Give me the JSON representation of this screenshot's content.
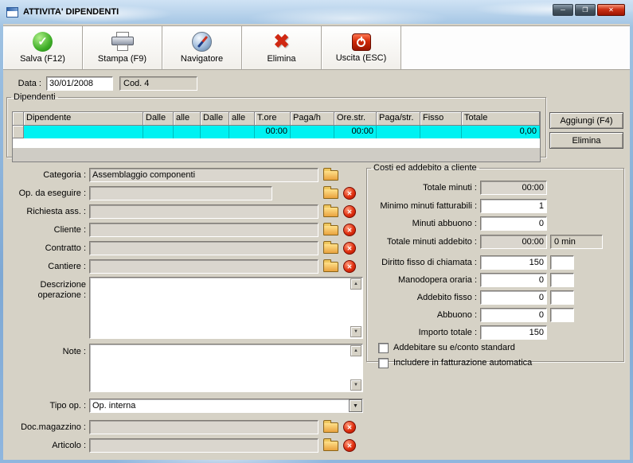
{
  "window": {
    "title": "ATTIVITA' DIPENDENTI"
  },
  "colors": {
    "titlebar": "#9ec1e4",
    "dialog_bg": "#d6d2c6",
    "selected_row": "#00f2f2",
    "close_button": "#cc3014"
  },
  "icons": {
    "check": "✓",
    "cross": "✖",
    "small_cross": "✕",
    "arrow_down": "▼",
    "arrow_up": "▲",
    "minimize": "─",
    "maximize": "❐",
    "close": "✕"
  },
  "toolbar": {
    "salva": "Salva (F12)",
    "stampa": "Stampa (F9)",
    "navigatore": "Navigatore",
    "elimina": "Elimina",
    "uscita": "Uscita (ESC)"
  },
  "header": {
    "data_label": "Data :",
    "data_value": "30/01/2008",
    "cod_value": "Cod. 4"
  },
  "grid": {
    "legend": "Dipendenti",
    "columns": [
      "Dipendente",
      "Dalle",
      "alle",
      "Dalle",
      "alle",
      "T.ore",
      "Paga/h",
      "Ore.str.",
      "Paga/str.",
      "Fisso",
      "Totale"
    ],
    "row": {
      "t_ore": "00:00",
      "ore_str": "00:00",
      "totale": "0,00"
    },
    "aggiungi": "Aggiungi (F4)",
    "elimina": "Elimina"
  },
  "form": {
    "categoria": {
      "label": "Categoria :",
      "value": "Assemblaggio componenti"
    },
    "op_da_eseguire": {
      "label": "Op. da eseguire :",
      "value": ""
    },
    "richiesta_ass": {
      "label": "Richiesta ass. :",
      "value": ""
    },
    "cliente": {
      "label": "Cliente :",
      "value": ""
    },
    "contratto": {
      "label": "Contratto :",
      "value": ""
    },
    "cantiere": {
      "label": "Cantiere :",
      "value": ""
    },
    "descrizione": {
      "label": "Descrizione operazione :",
      "value": ""
    },
    "note": {
      "label": "Note :",
      "value": ""
    },
    "tipo_op": {
      "label": "Tipo op. :",
      "value": "Op. interna"
    },
    "doc_magazzino": {
      "label": "Doc.magazzino :",
      "value": ""
    },
    "articolo": {
      "label": "Articolo :",
      "value": ""
    }
  },
  "costi": {
    "legend": "Costi ed addebito a cliente",
    "totale_minuti": {
      "label": "Totale minuti :",
      "value": "00:00"
    },
    "minimo_minuti": {
      "label": "Minimo minuti fatturabili :",
      "value": "1"
    },
    "minuti_abbuono": {
      "label": "Minuti abbuono :",
      "value": "0"
    },
    "totale_minuti_addebito": {
      "label": "Totale minuti addebito :",
      "value": "00:00",
      "extra": "0 min"
    },
    "diritto_fisso": {
      "label": "Diritto fisso di chiamata :",
      "value": "150",
      "extra": ""
    },
    "manodopera": {
      "label": "Manodopera oraria :",
      "value": "0",
      "extra": ""
    },
    "addebito_fisso": {
      "label": "Addebito fisso :",
      "value": "0",
      "extra": ""
    },
    "abbuono": {
      "label": "Abbuono :",
      "value": "0",
      "extra": ""
    },
    "importo_totale": {
      "label": "Importo totale :",
      "value": "150"
    },
    "check1": "Addebitare su e/conto standard",
    "check2": "Includere in fatturazione automatica"
  }
}
